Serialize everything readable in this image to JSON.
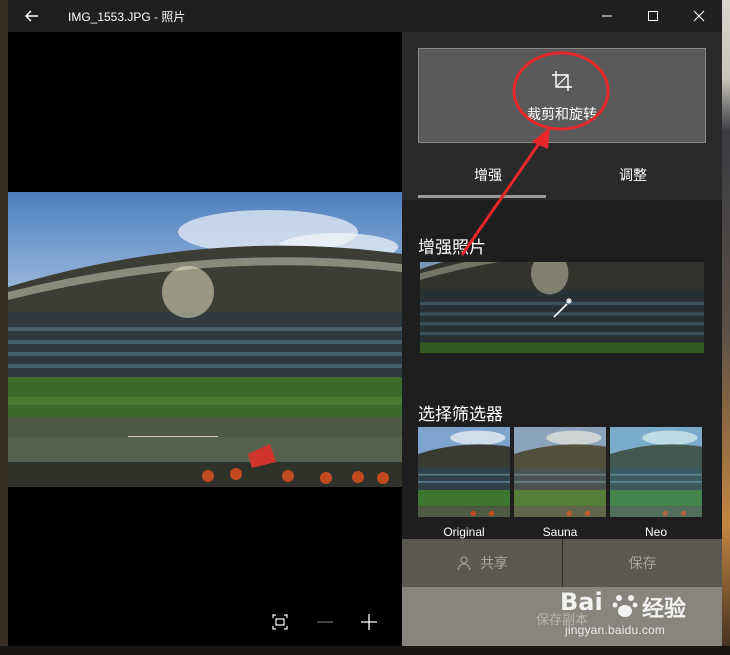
{
  "window": {
    "title": "IMG_1553.JPG - 照片"
  },
  "titlebar": {
    "back_icon": "back-arrow-icon",
    "minimize_icon": "minimize-icon",
    "maximize_icon": "maximize-icon",
    "close_icon": "close-icon"
  },
  "viewer": {
    "controls": [
      "fit-screen-icon",
      "zoom-out-icon",
      "zoom-in-icon"
    ]
  },
  "edit_panel": {
    "crop_rotate_label": "裁剪和旋转",
    "tabs": [
      {
        "label": "增强",
        "active": true
      },
      {
        "label": "调整",
        "active": false
      }
    ],
    "enhance_title": "增强照片",
    "filter_title": "选择筛选器",
    "filters": [
      {
        "label": "Original"
      },
      {
        "label": "Sauna"
      },
      {
        "label": "Neo"
      }
    ],
    "share_label": "共享",
    "save_label": "保存",
    "save_copy_label": "保存副本"
  },
  "watermark": {
    "brand": "Bai",
    "brand_cn": "经验",
    "url": "jingyan.baidu.com"
  },
  "colors": {
    "annotation": "#e8272a",
    "panel_bg": "#1e1e1e",
    "titlebar_bg": "#1f1f1f"
  }
}
